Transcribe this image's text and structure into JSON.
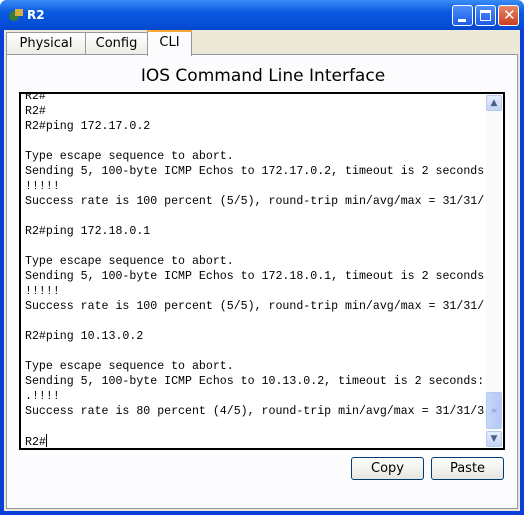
{
  "window": {
    "title": "R2",
    "accent": "#0a5ae0"
  },
  "tabs": [
    {
      "label": "Physical"
    },
    {
      "label": "Config"
    },
    {
      "label": "CLI",
      "active": true
    }
  ],
  "cli": {
    "heading": "IOS Command Line Interface",
    "lines": [
      "R2#",
      "R2#",
      "R2#ping 172.17.0.2",
      "",
      "Type escape sequence to abort.",
      "Sending 5, 100-byte ICMP Echos to 172.17.0.2, timeout is 2 seconds",
      "!!!!!",
      "Success rate is 100 percent (5/5), round-trip min/avg/max = 31/31/",
      "",
      "R2#ping 172.18.0.1",
      "",
      "Type escape sequence to abort.",
      "Sending 5, 100-byte ICMP Echos to 172.18.0.1, timeout is 2 seconds",
      "!!!!!",
      "Success rate is 100 percent (5/5), round-trip min/avg/max = 31/31/",
      "",
      "R2#ping 10.13.0.2",
      "",
      "Type escape sequence to abort.",
      "Sending 5, 100-byte ICMP Echos to 10.13.0.2, timeout is 2 seconds:",
      ".!!!!",
      "Success rate is 80 percent (4/5), round-trip min/avg/max = 31/31/3",
      ""
    ],
    "prompt": "R2#"
  },
  "buttons": {
    "copy": "Copy",
    "paste": "Paste"
  }
}
